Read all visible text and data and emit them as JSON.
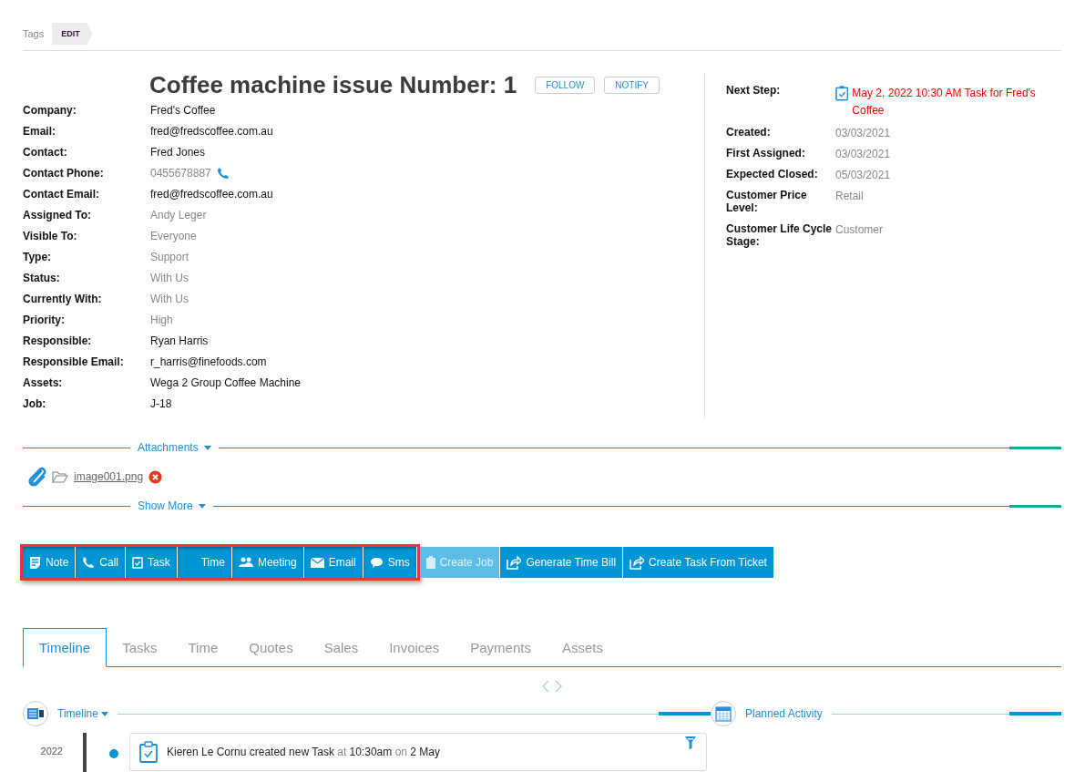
{
  "tags": {
    "label": "Tags",
    "edit_button": "EDIT"
  },
  "title": "Coffee machine issue Number: 1",
  "header_buttons": [
    "FOLLOW",
    "NOTIFY"
  ],
  "details": [
    {
      "label": "Company:",
      "value": "Fred's Coffee",
      "dimmed": false,
      "kind": "text"
    },
    {
      "label": "Email:",
      "value": "fred@fredscoffee.com.au",
      "dimmed": false,
      "kind": "text"
    },
    {
      "label": "Contact:",
      "value": "Fred Jones",
      "dimmed": false,
      "kind": "text"
    },
    {
      "label": "Contact Phone:",
      "value": "0455678887",
      "dimmed": true,
      "kind": "phone"
    },
    {
      "label": "Contact Email:",
      "value": "fred@fredscoffee.com.au",
      "dimmed": false,
      "kind": "text"
    },
    {
      "label": "Assigned To:",
      "value": "Andy Leger",
      "dimmed": true,
      "kind": "text"
    },
    {
      "label": "Visible To:",
      "value": "Everyone",
      "dimmed": true,
      "kind": "text"
    },
    {
      "label": "Type:",
      "value": "Support",
      "dimmed": true,
      "kind": "text"
    },
    {
      "label": "Status:",
      "value": "With Us",
      "dimmed": true,
      "kind": "text"
    },
    {
      "label": "Currently With:",
      "value": "With Us",
      "dimmed": true,
      "kind": "text"
    },
    {
      "label": "Priority:",
      "value": "High",
      "dimmed": true,
      "kind": "text"
    },
    {
      "label": "Responsible:",
      "value": "Ryan Harris",
      "dimmed": false,
      "kind": "text"
    },
    {
      "label": "Responsible Email:",
      "value": "r_harris@finefoods.com",
      "dimmed": false,
      "kind": "text"
    },
    {
      "label": "Assets:",
      "value": "Wega 2 Group Coffee Machine",
      "dimmed": false,
      "kind": "text"
    },
    {
      "label": "Job:",
      "value": "J-18",
      "dimmed": false,
      "kind": "text"
    }
  ],
  "side_details": [
    {
      "label": "Next Step:",
      "value": "May 2, 2022 10:30 AM Task for Fred's Coffee",
      "kind": "next-step"
    },
    {
      "label": "Created:",
      "value": "03/03/2021",
      "kind": "text"
    },
    {
      "label": "First Assigned:",
      "value": "03/03/2021",
      "kind": "text"
    },
    {
      "label": "Expected Closed:",
      "value": "05/03/2021",
      "kind": "text"
    },
    {
      "label": "Customer Price Level:",
      "value": "Retail",
      "kind": "text"
    },
    {
      "label": "Customer Life Cycle Stage:",
      "value": "Customer",
      "kind": "text"
    }
  ],
  "attachments": {
    "heading": "Attachments",
    "files": [
      "image001.png"
    ]
  },
  "show_more": "Show More",
  "actions": [
    {
      "label": "Note",
      "kind": "note",
      "highlighted": true,
      "disabled": false
    },
    {
      "label": "Call",
      "kind": "call",
      "highlighted": true,
      "disabled": false
    },
    {
      "label": "Task",
      "kind": "task",
      "highlighted": true,
      "disabled": false
    },
    {
      "label": "Time",
      "kind": "time",
      "highlighted": true,
      "disabled": false
    },
    {
      "label": "Meeting",
      "kind": "meeting",
      "highlighted": true,
      "disabled": false
    },
    {
      "label": "Email",
      "kind": "email",
      "highlighted": true,
      "disabled": false
    },
    {
      "label": "Sms",
      "kind": "sms",
      "highlighted": true,
      "disabled": false
    },
    {
      "label": "Create Job",
      "kind": "job",
      "highlighted": false,
      "disabled": true
    },
    {
      "label": "Generate Time Bill",
      "kind": "export",
      "highlighted": false,
      "disabled": false
    },
    {
      "label": "Create Task From Ticket",
      "kind": "export",
      "highlighted": false,
      "disabled": false
    }
  ],
  "tabs": [
    {
      "label": "Timeline",
      "selected": true
    },
    {
      "label": "Tasks",
      "selected": false
    },
    {
      "label": "Time",
      "selected": false
    },
    {
      "label": "Quotes",
      "selected": false
    },
    {
      "label": "Sales",
      "selected": false
    },
    {
      "label": "Invoices",
      "selected": false
    },
    {
      "label": "Payments",
      "selected": false
    },
    {
      "label": "Assets",
      "selected": false
    }
  ],
  "timeline": {
    "heading": "Timeline",
    "planned_heading": "Planned Activity",
    "entries": [
      {
        "year": "2022",
        "parts": [
          {
            "text": "Kieren Le Cornu created new Task",
            "dimmed": false
          },
          {
            "text": "at",
            "dimmed": true
          },
          {
            "text": "10:30am",
            "dimmed": false
          },
          {
            "text": "on",
            "dimmed": true
          },
          {
            "text": "2 May",
            "dimmed": false
          }
        ]
      }
    ]
  }
}
